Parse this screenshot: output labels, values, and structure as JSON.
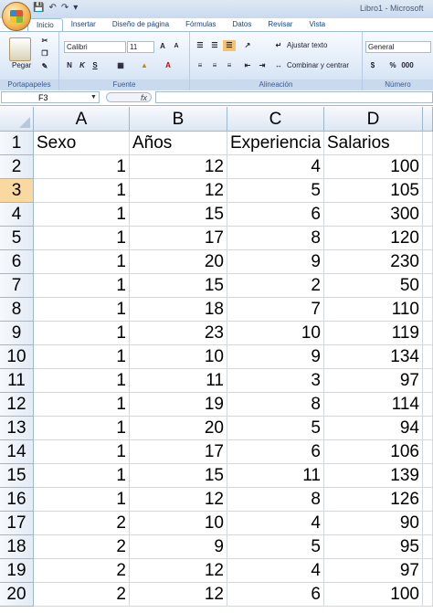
{
  "window": {
    "title": "Libro1 - Microsoft"
  },
  "tabs": [
    "Inicio",
    "Insertar",
    "Diseño de página",
    "Fórmulas",
    "Datos",
    "Revisar",
    "Vista"
  ],
  "ribbon": {
    "clipboard": {
      "paste_label": "Pegar",
      "group_label": "Portapapeles"
    },
    "font": {
      "font_name": "Calibri",
      "font_size": "11",
      "group_label": "Fuente"
    },
    "alignment": {
      "wrap_label": "Ajustar texto",
      "merge_label": "Combinar y centrar",
      "group_label": "Alineación"
    },
    "number": {
      "format": "General",
      "group_label": "Número"
    }
  },
  "formula_bar": {
    "name_box": "F3",
    "fx": "fx",
    "content": ""
  },
  "sheet": {
    "columns": [
      "A",
      "B",
      "C",
      "D"
    ],
    "rows": [
      {
        "n": "1",
        "cells": [
          "Sexo",
          "Años",
          "Experiencia",
          "Salarios"
        ]
      },
      {
        "n": "2",
        "cells": [
          "1",
          "12",
          "4",
          "100"
        ]
      },
      {
        "n": "3",
        "cells": [
          "1",
          "12",
          "5",
          "105"
        ]
      },
      {
        "n": "4",
        "cells": [
          "1",
          "15",
          "6",
          "300"
        ]
      },
      {
        "n": "5",
        "cells": [
          "1",
          "17",
          "8",
          "120"
        ]
      },
      {
        "n": "6",
        "cells": [
          "1",
          "20",
          "9",
          "230"
        ]
      },
      {
        "n": "7",
        "cells": [
          "1",
          "15",
          "2",
          "50"
        ]
      },
      {
        "n": "8",
        "cells": [
          "1",
          "18",
          "7",
          "110"
        ]
      },
      {
        "n": "9",
        "cells": [
          "1",
          "23",
          "10",
          "119"
        ]
      },
      {
        "n": "10",
        "cells": [
          "1",
          "10",
          "9",
          "134"
        ]
      },
      {
        "n": "11",
        "cells": [
          "1",
          "11",
          "3",
          "97"
        ]
      },
      {
        "n": "12",
        "cells": [
          "1",
          "19",
          "8",
          "114"
        ]
      },
      {
        "n": "13",
        "cells": [
          "1",
          "20",
          "5",
          "94"
        ]
      },
      {
        "n": "14",
        "cells": [
          "1",
          "17",
          "6",
          "106"
        ]
      },
      {
        "n": "15",
        "cells": [
          "1",
          "15",
          "11",
          "139"
        ]
      },
      {
        "n": "16",
        "cells": [
          "1",
          "12",
          "8",
          "126"
        ]
      },
      {
        "n": "17",
        "cells": [
          "2",
          "10",
          "4",
          "90"
        ]
      },
      {
        "n": "18",
        "cells": [
          "2",
          "9",
          "5",
          "95"
        ]
      },
      {
        "n": "19",
        "cells": [
          "2",
          "12",
          "4",
          "97"
        ]
      },
      {
        "n": "20",
        "cells": [
          "2",
          "12",
          "6",
          "100"
        ]
      }
    ],
    "selected_row": "3"
  }
}
